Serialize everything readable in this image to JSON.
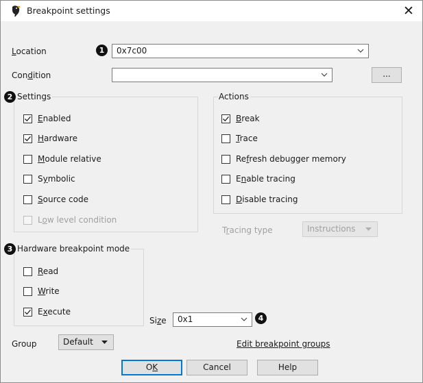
{
  "window": {
    "title": "Breakpoint settings",
    "close_glyph": "✕"
  },
  "location": {
    "label": "Location",
    "value": "0x7c00",
    "badge": "1"
  },
  "condition": {
    "label": "Condition",
    "value": "",
    "ellipsis_label": "..."
  },
  "settings": {
    "title": "Settings",
    "badge": "2",
    "items": [
      {
        "label": "Enabled",
        "checked": true,
        "enabled": true
      },
      {
        "label": "Hardware",
        "checked": true,
        "enabled": true
      },
      {
        "label": "Module relative",
        "checked": false,
        "enabled": true
      },
      {
        "label": "Symbolic",
        "checked": false,
        "enabled": true
      },
      {
        "label": "Source code",
        "checked": false,
        "enabled": true
      },
      {
        "label": "Low level condition",
        "checked": false,
        "enabled": false
      }
    ]
  },
  "actions": {
    "title": "Actions",
    "items": [
      {
        "label": "Break",
        "checked": true
      },
      {
        "label": "Trace",
        "checked": false
      },
      {
        "label": "Refresh debugger memory",
        "checked": false
      },
      {
        "label": "Enable tracing",
        "checked": false
      },
      {
        "label": "Disable tracing",
        "checked": false
      }
    ]
  },
  "tracing": {
    "label": "Tracing type",
    "value": "Instructions",
    "enabled": false
  },
  "hw_mode": {
    "title": "Hardware breakpoint mode",
    "badge": "3",
    "items": [
      {
        "label": "Read",
        "checked": false
      },
      {
        "label": "Write",
        "checked": false
      },
      {
        "label": "Execute",
        "checked": true
      }
    ]
  },
  "size": {
    "label": "Size",
    "value": "0x1",
    "badge": "4"
  },
  "group": {
    "label": "Group",
    "value": "Default"
  },
  "edit_groups_link": "Edit breakpoint groups",
  "buttons": {
    "ok": "OK",
    "cancel": "Cancel",
    "help": "Help"
  },
  "colors": {
    "dialog_bg": "#f0f0f0",
    "default_button_border": "#0078d7",
    "disabled_text": "#a0a0a0"
  }
}
